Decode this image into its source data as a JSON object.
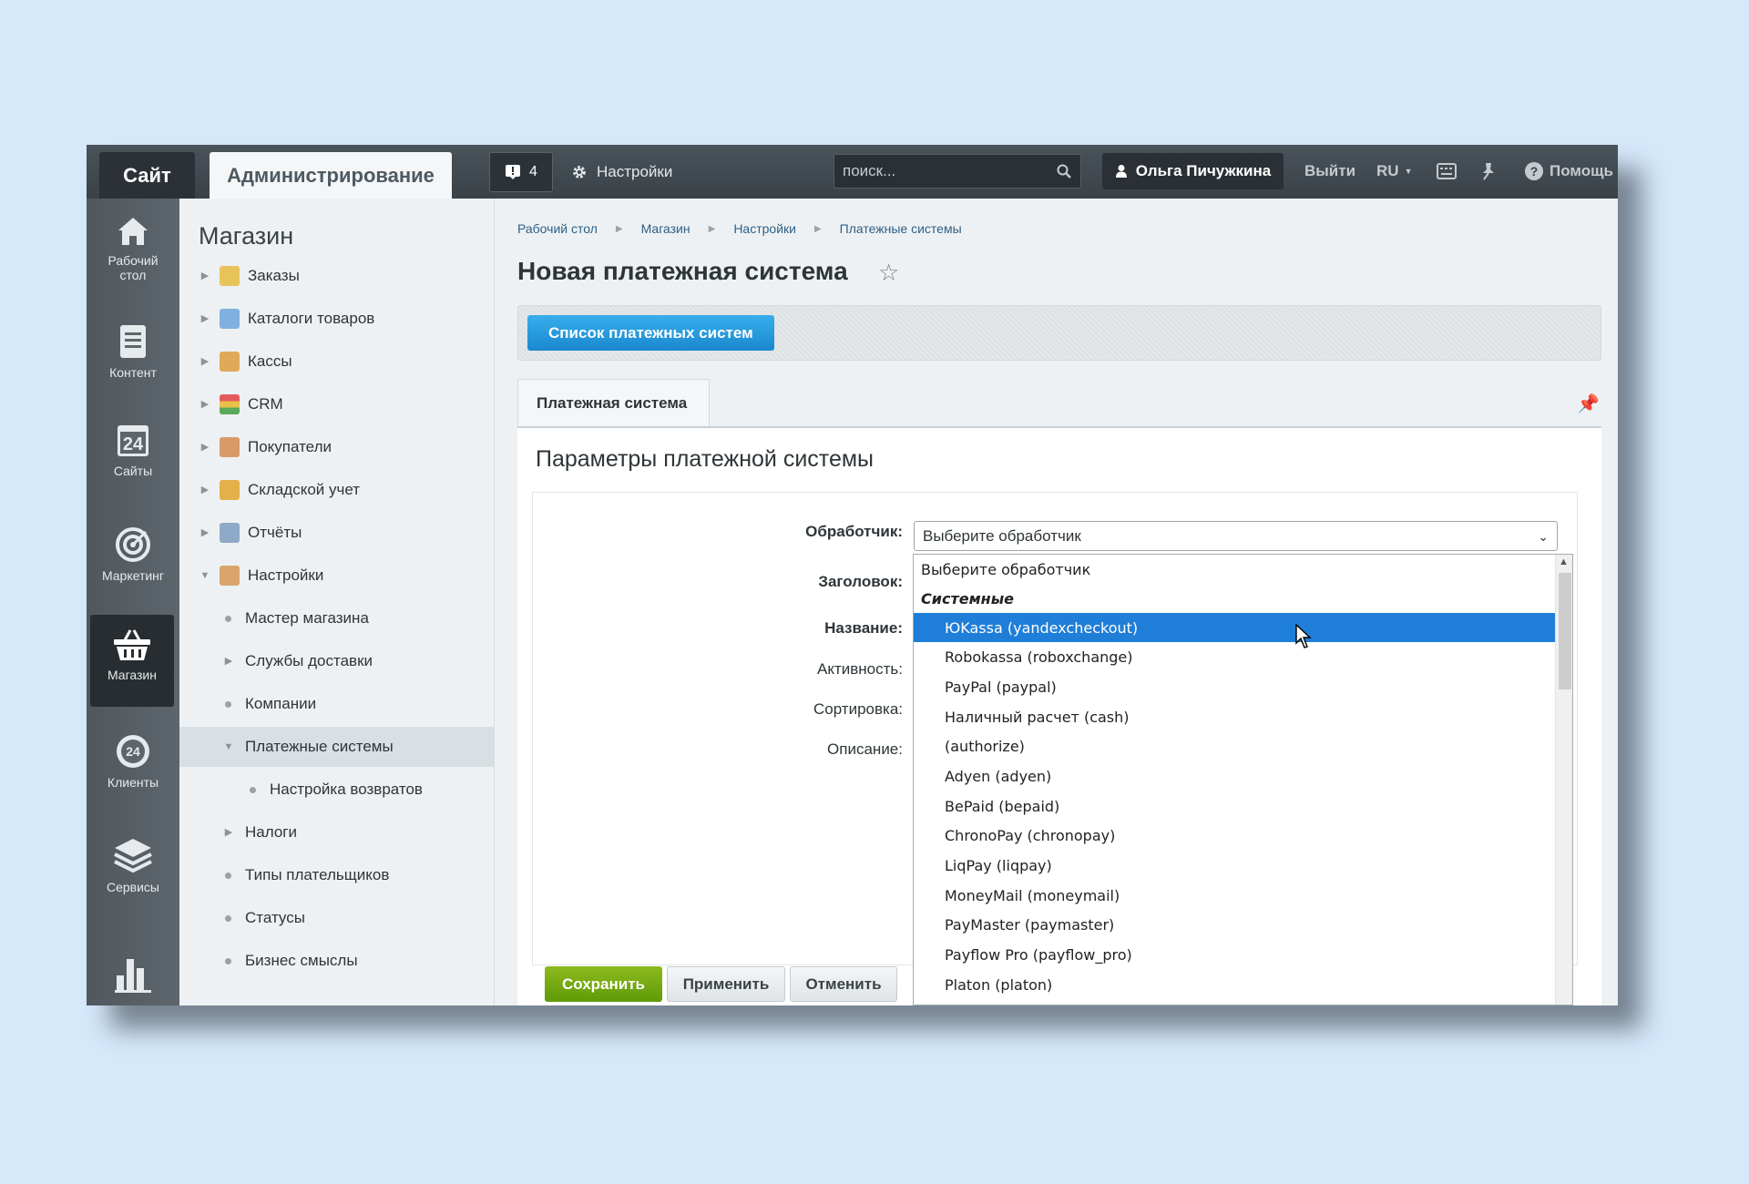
{
  "topbar": {
    "site_tab": "Сайт",
    "admin_tab": "Администрирование",
    "notifications_count": "4",
    "settings_label": "Настройки",
    "search_placeholder": "поиск...",
    "user_name": "Ольга Пичужкина",
    "logout_label": "Выйти",
    "language": "RU",
    "help_label": "Помощь"
  },
  "left_nav": [
    {
      "label": "Рабочий\nстол",
      "icon": "home-icon"
    },
    {
      "label": "Контент",
      "icon": "document-icon"
    },
    {
      "label": "Сайты",
      "icon": "calendar-24-icon"
    },
    {
      "label": "Маркетинг",
      "icon": "target-icon"
    },
    {
      "label": "Магазин",
      "icon": "basket-icon",
      "active": true
    },
    {
      "label": "Клиенты",
      "icon": "clients-24-icon"
    },
    {
      "label": "Сервисы",
      "icon": "layers-icon"
    },
    {
      "label": "",
      "icon": "chart-bars-icon"
    }
  ],
  "sidebar": {
    "title": "Магазин",
    "items": [
      {
        "label": "Заказы",
        "icon": "orders-icon"
      },
      {
        "label": "Каталоги товаров",
        "icon": "folder-icon"
      },
      {
        "label": "Кассы",
        "icon": "cash-register-icon"
      },
      {
        "label": "CRM",
        "icon": "crm-funnel-icon"
      },
      {
        "label": "Покупатели",
        "icon": "customers-icon"
      },
      {
        "label": "Складской учет",
        "icon": "warehouse-icon"
      },
      {
        "label": "Отчёты",
        "icon": "reports-icon"
      },
      {
        "label": "Настройки",
        "icon": "settings-clipboard-icon"
      },
      {
        "label": "Мастер магазина"
      },
      {
        "label": "Службы доставки"
      },
      {
        "label": "Компании"
      },
      {
        "label": "Платежные системы"
      },
      {
        "label": "Настройка возвратов"
      },
      {
        "label": "Налоги"
      },
      {
        "label": "Типы плательщиков"
      },
      {
        "label": "Статусы"
      },
      {
        "label": "Бизнес смыслы"
      }
    ]
  },
  "breadcrumb": [
    "Рабочий стол",
    "Магазин",
    "Настройки",
    "Платежные системы"
  ],
  "page_title": "Новая платежная система",
  "context_button": "Список платежных систем",
  "tab_label": "Платежная система",
  "section_title": "Параметры платежной системы",
  "form": {
    "handler_label": "Обработчик:",
    "handler_value": "Выберите обработчик",
    "title_label": "Заголовок:",
    "name_label": "Название:",
    "active_label": "Активность:",
    "sort_label": "Сортировка:",
    "description_label": "Описание:"
  },
  "dropdown": {
    "options": [
      "Выберите обработчик",
      "Системные",
      "ЮKassa (yandexcheckout)",
      "Robokassa (roboxchange)",
      "PayPal (paypal)",
      "Наличный расчет (cash)",
      "(authorize)",
      "Adyen (adyen)",
      "BePaid (bepaid)",
      "ChronoPay (chronopay)",
      "LiqPay (liqpay)",
      "MoneyMail (moneymail)",
      "PayMaster (paymaster)",
      "Payflow Pro (payflow_pro)",
      "Platon (platon)"
    ],
    "selected_index": 2
  },
  "buttons": {
    "save": "Сохранить",
    "apply": "Применить",
    "cancel": "Отменить"
  },
  "colors": {
    "topbar": "#3f474d",
    "accent_blue": "#1f7ed8",
    "save_green": "#6fa80f"
  }
}
